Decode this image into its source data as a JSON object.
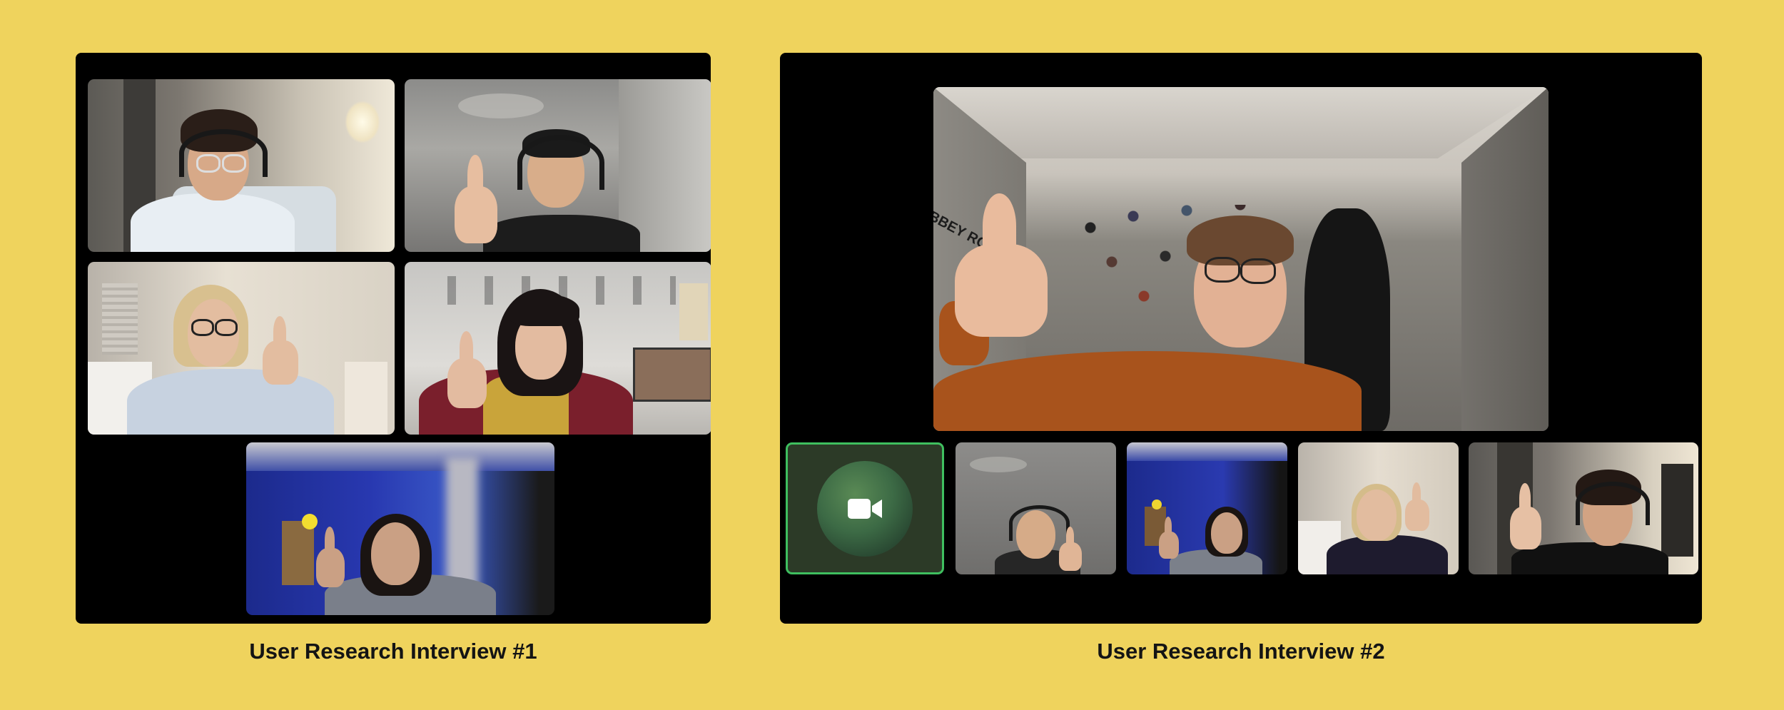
{
  "captions": {
    "interview1": "User Research Interview #1",
    "interview2": "User Research Interview #2"
  },
  "panel1": {
    "participants": [
      "participant-1",
      "participant-2",
      "participant-3",
      "participant-4",
      "participant-5"
    ]
  },
  "panel2": {
    "self_view": {
      "camera_icon": "video-camera-icon",
      "active_speaker_border": "#3fbf5f"
    },
    "wall_text": "BBEY ROA"
  },
  "colors": {
    "background": "#efd35d",
    "panel": "#000000",
    "caption": "#141414"
  }
}
